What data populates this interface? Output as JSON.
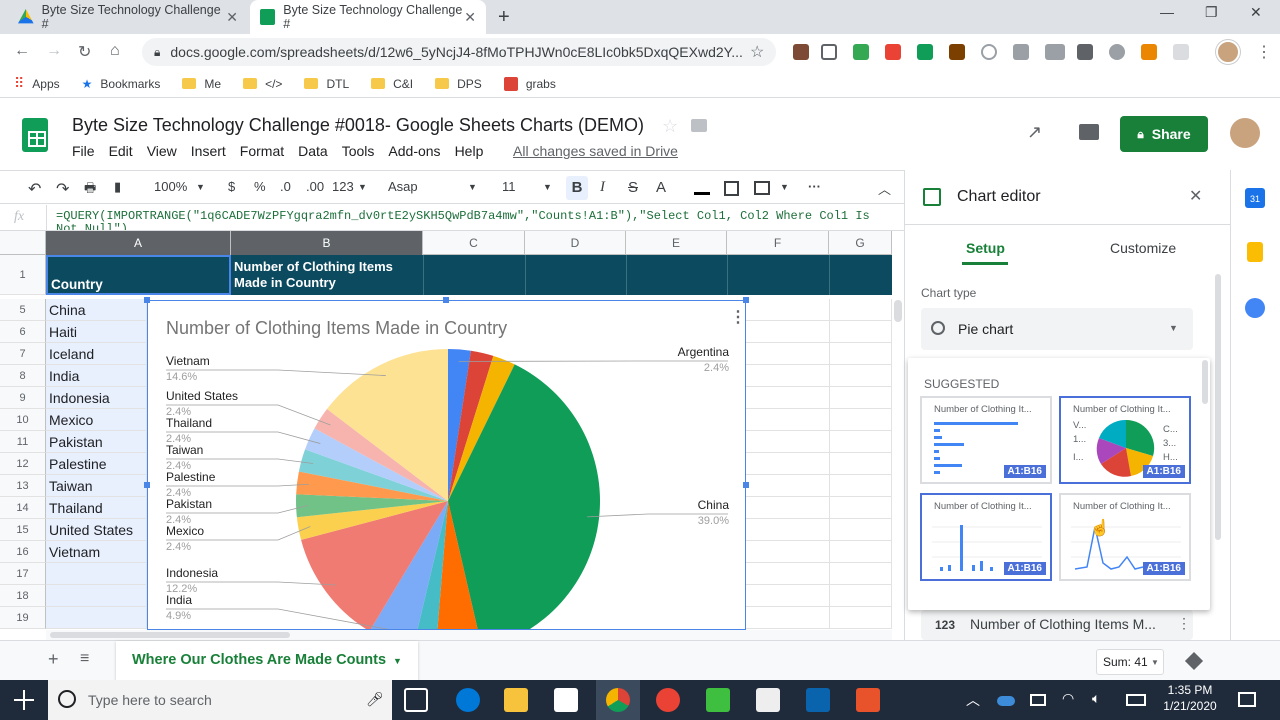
{
  "browser": {
    "tabs": [
      {
        "title": "Byte Size Technology Challenge #"
      },
      {
        "title": "Byte Size Technology Challenge #"
      }
    ],
    "url": "docs.google.com/spreadsheets/d/12w6_5yNcjJ4-8fMoTPHJWn0cE8LIc0bk5DxqQEXwd2Y...",
    "bookmarks": [
      {
        "label": "Apps"
      },
      {
        "label": "Bookmarks"
      },
      {
        "label": "Me"
      },
      {
        "label": "</>"
      },
      {
        "label": "DTL"
      },
      {
        "label": "C&I"
      },
      {
        "label": "DPS"
      },
      {
        "label": "grabs"
      }
    ]
  },
  "doc": {
    "title": "Byte Size Technology Challenge #0018- Google Sheets Charts (DEMO)",
    "menu": [
      "File",
      "Edit",
      "View",
      "Insert",
      "Format",
      "Data",
      "Tools",
      "Add-ons",
      "Help"
    ],
    "save_status": "All changes saved in Drive",
    "share_label": "Share"
  },
  "toolbar": {
    "zoom": "100%",
    "currency": "$",
    "percent": "%",
    "dec_less": ".0",
    "dec_more": ".00",
    "format_more": "123",
    "font": "Asap",
    "font_size": "11",
    "bold": "B",
    "italic": "I",
    "strike": "S",
    "textcolor": "A"
  },
  "formula": "=QUERY(IMPORTRANGE(\"1q6CADE7WzPFYgqra2mfn_dv0rtE2ySKH5QwPdB7a4mw\",\"Counts!A1:B\"),\"Select Col1, Col2 Where Col1 Is Not Null\")",
  "grid": {
    "columns": [
      "A",
      "B",
      "C",
      "D",
      "E",
      "F",
      "G"
    ],
    "row_numbers": [
      "1",
      "5",
      "6",
      "7",
      "8",
      "9",
      "10",
      "11",
      "12",
      "13",
      "14",
      "15",
      "16",
      "17",
      "18",
      "19"
    ],
    "header_a": "Country",
    "header_b": "Number of Clothing Items Made in Country",
    "countries": [
      "China",
      "Haiti",
      "Iceland",
      "India",
      "Indonesia",
      "Mexico",
      "Pakistan",
      "Palestine",
      "Taiwan",
      "Thailand",
      "United States",
      "Vietnam"
    ]
  },
  "chart_data": {
    "type": "pie",
    "title": "Number of Clothing Items Made in Country",
    "slices": [
      {
        "label": "Argentina",
        "pct": "2.4%",
        "value": 2.4,
        "color": "#4285f4"
      },
      {
        "label": "",
        "pct": "",
        "value": 2.4,
        "color": "#db4437"
      },
      {
        "label": "",
        "pct": "",
        "value": 2.4,
        "color": "#f4b400"
      },
      {
        "label": "China",
        "pct": "39.0%",
        "value": 39.0,
        "color": "#0f9d58"
      },
      {
        "label": "",
        "pct": "",
        "value": 4.9,
        "color": "#ff6d00"
      },
      {
        "label": "",
        "pct": "",
        "value": 2.4,
        "color": "#46bdc6"
      },
      {
        "label": "India",
        "pct": "4.9%",
        "value": 4.9,
        "color": "#7baaf7"
      },
      {
        "label": "Indonesia",
        "pct": "12.2%",
        "value": 12.2,
        "color": "#f07b72"
      },
      {
        "label": "Mexico",
        "pct": "2.4%",
        "value": 2.4,
        "color": "#fcd04f"
      },
      {
        "label": "Pakistan",
        "pct": "2.4%",
        "value": 2.4,
        "color": "#71c287"
      },
      {
        "label": "Palestine",
        "pct": "2.4%",
        "value": 2.4,
        "color": "#ff994d"
      },
      {
        "label": "Taiwan",
        "pct": "2.4%",
        "value": 2.4,
        "color": "#7ed1d7"
      },
      {
        "label": "Thailand",
        "pct": "2.4%",
        "value": 2.4,
        "color": "#b3cefb"
      },
      {
        "label": "United States",
        "pct": "2.4%",
        "value": 2.4,
        "color": "#f7b4ae"
      },
      {
        "label": "Vietnam",
        "pct": "14.6%",
        "value": 14.6,
        "color": "#fde293"
      }
    ]
  },
  "editor": {
    "title": "Chart editor",
    "tab_setup": "Setup",
    "tab_customize": "Customize",
    "chart_type_label": "Chart type",
    "chart_type_value": "Pie chart",
    "suggested_label": "SUGGESTED",
    "thumb_title": "Number of Clothing It...",
    "range_badge": "A1:B16",
    "pie_thumb_labels": [
      "V...",
      "C...",
      "1...",
      "3...",
      "I...",
      "H..."
    ],
    "series_item": "Number of Clothing Items M...",
    "series_icon": "123"
  },
  "sheetbar": {
    "sheet_name": "Where Our Clothes Are Made Counts",
    "sum": "Sum: 41"
  },
  "taskbar": {
    "search_placeholder": "Type here to search",
    "time": "1:35 PM",
    "date": "1/21/2020"
  },
  "colors": {
    "header_fill": "#0b4a5f",
    "share_green": "#188038",
    "sheets_green": "#0f9d58",
    "selection_blue": "#4a86e8"
  }
}
